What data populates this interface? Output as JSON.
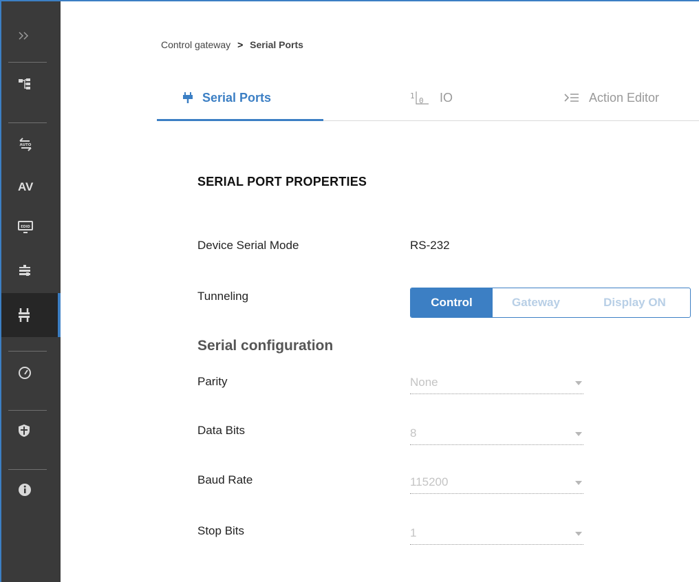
{
  "sidebar": {
    "items": [
      {
        "name": "expand-sidebar",
        "icon": "double-chevron-right-icon"
      },
      {
        "name": "routing",
        "icon": "hierarchy-icon"
      },
      {
        "name": "auto-switching",
        "icon": "auto-switch-icon",
        "icon_text": "AUTO"
      },
      {
        "name": "av",
        "label": "AV"
      },
      {
        "name": "edid",
        "icon": "edid-icon",
        "icon_text": "EDID"
      },
      {
        "name": "settings",
        "icon": "sliders-icon"
      },
      {
        "name": "control-gateway",
        "icon": "serial-connector-icon",
        "active": true
      },
      {
        "name": "dashboard",
        "icon": "speedometer-icon"
      },
      {
        "name": "security",
        "icon": "shield-icon"
      },
      {
        "name": "about",
        "icon": "info-icon"
      }
    ]
  },
  "breadcrumb": {
    "parent": "Control gateway",
    "separator": ">",
    "current": "Serial Ports"
  },
  "tabs": [
    {
      "label": "Serial Ports",
      "icon": "serial-port-icon",
      "active": true
    },
    {
      "label": "IO",
      "icon": "io-icon"
    },
    {
      "label": "Action Editor",
      "icon": "action-list-icon"
    }
  ],
  "section_title": "SERIAL PORT PROPERTIES",
  "device_serial_mode": {
    "label": "Device Serial Mode",
    "value": "RS-232"
  },
  "tunneling": {
    "label": "Tunneling",
    "options": [
      "Control",
      "Gateway",
      "Display ON"
    ],
    "selected": "Control"
  },
  "serial_configuration": {
    "heading": "Serial configuration",
    "fields": [
      {
        "label": "Parity",
        "value": "None"
      },
      {
        "label": "Data Bits",
        "value": "8"
      },
      {
        "label": "Baud Rate",
        "value": "115200"
      },
      {
        "label": "Stop Bits",
        "value": "1"
      }
    ]
  },
  "colors": {
    "accent": "#3c7fc4",
    "sidebar_bg": "#3a3a3a",
    "sidebar_active_bg": "#262626",
    "disabled_text": "#c4c4c4"
  }
}
